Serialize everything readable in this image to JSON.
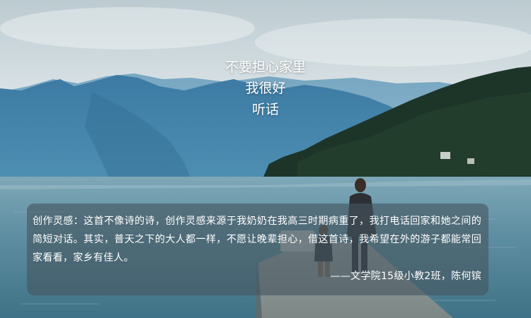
{
  "poem": {
    "lines": [
      "不要担心家里",
      "我很好",
      "听话"
    ]
  },
  "caption": {
    "body": "创作灵感：这首不像诗的诗，创作灵感来源于我奶奶在我高三时期病重了，我打电话回家和她之间的简短对话。其实，普天之下的大人都一样，不愿让晚辈担心，借这首诗，我希望在外的游子都能常回家看看，家乡有佳人。",
    "credit": "——文学院15级小教2班，陈何镔"
  },
  "colors": {
    "sky_top": "#c9d5da",
    "sky_horizon": "#e9eeef",
    "mountain": "#3f7fa6",
    "forest": "#1f3a2c",
    "lake": "#5d8ea1",
    "pier": "#8f9a98",
    "caption_bg": "#46555f"
  }
}
